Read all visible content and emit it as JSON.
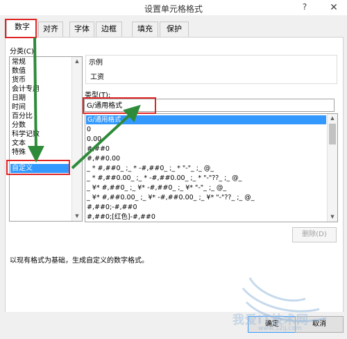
{
  "window": {
    "title": "设置单元格格式",
    "help": "?",
    "close": "✕"
  },
  "tabs": [
    {
      "label": "数字",
      "active": true
    },
    {
      "label": "对齐",
      "active": false
    },
    {
      "label": "字体",
      "active": false
    },
    {
      "label": "边框",
      "active": false
    },
    {
      "label": "填充",
      "active": false
    },
    {
      "label": "保护",
      "active": false
    }
  ],
  "category": {
    "label": "分类(C):",
    "items": [
      "常规",
      "数值",
      "货币",
      "会计专用",
      "日期",
      "时间",
      "百分比",
      "分数",
      "科学记数",
      "文本",
      "特殊",
      "自定义"
    ],
    "selected": "自定义"
  },
  "sample": {
    "label": "示例",
    "value": "工资"
  },
  "type": {
    "label": "类型(T):",
    "value": "G/通用格式",
    "items": [
      "G/通用格式",
      "0",
      "0.00",
      "#,##0",
      "#,##0.00",
      "_ * #,##0_ ;_ * -#,##0_ ;_ * \"-\"_ ;_ @_",
      "_ * #,##0.00_ ;_ * -#,##0.00_ ;_ * \"-\"??_ ;_ @_",
      "_ ¥* #,##0_ ;_ ¥* -#,##0_ ;_ ¥* \"-\"_ ;_ @_",
      "_ ¥* #,##0.00_ ;_ ¥* -#,##0.00_ ;_ ¥* \"-\"??_ ;_ @_",
      "#,##0;-#,##0",
      "#,##0;[红色]-#,##0"
    ]
  },
  "delete_button": "删除(D)",
  "description": "以现有格式为基础，生成自定义的数字格式。",
  "buttons": {
    "ok": "确定",
    "cancel": "取消"
  },
  "watermark": {
    "text": "我爱IT技术网",
    "url": "www.52ij.com"
  },
  "colors": {
    "annotation_red": "#e02424",
    "annotation_arrow": "#2e8b3a",
    "selection_blue": "#3399ff"
  }
}
